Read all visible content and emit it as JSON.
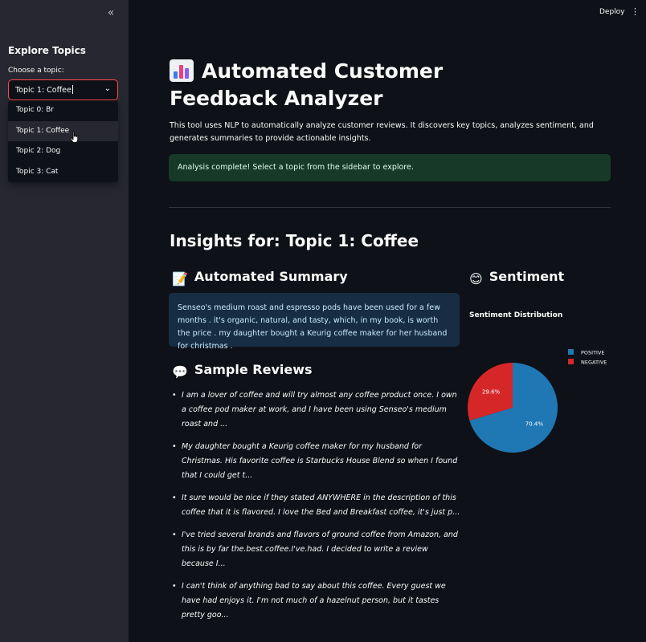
{
  "sidebar": {
    "collapse_icon": "double-chevron-left-icon",
    "title": "Explore Topics",
    "select_label": "Choose a topic:",
    "select_value": "Topic 1: Coffee",
    "options": [
      "Topic 0: Br",
      "Topic 1: Coffee",
      "Topic 2: Dog",
      "Topic 3: Cat"
    ],
    "hovered_option": "Topic 1: Coffee"
  },
  "toolbar": {
    "deploy_label": "Deploy",
    "menu_icon": "kebab-menu-icon"
  },
  "main": {
    "title": "Automated Customer Feedback Analyzer",
    "title_icon": "bar-chart-emoji",
    "description": "This tool uses NLP to automatically analyze customer reviews. It discovers key topics, analyzes sentiment, and generates summaries to provide actionable insights.",
    "success_message": "Analysis complete! Select a topic from the sidebar to explore.",
    "insights_heading": "Insights for: Topic 1: Coffee",
    "summary_heading": "Automated Summary",
    "summary_icon": "memo-emoji",
    "summary_text": "Senseo's medium roast and espresso pods have been used for a few months . it's organic, natural, and tasty, which, in my book, is worth the price . my daughter bought a Keurig coffee maker for her husband for christmas .",
    "reviews_heading": "Sample Reviews",
    "reviews_icon": "speech-bubble-emoji",
    "reviews": [
      "I am a lover of coffee and will try almost any coffee product once. I own a coffee pod maker at work, and I have been using Senseo's medium roast and ...",
      "My daughter bought a Keurig coffee maker for my husband for Christmas. His favorite coffee is Starbucks House Blend so when I found that I could get t...",
      "It sure would be nice if they stated ANYWHERE in the description of this coffee that it is flavored. I love the Bed and Breakfast coffee, it's just p...",
      "I've tried several brands and flavors of ground coffee from Amazon, and this is by far the.best.coffee.I've.had. I decided to write a review because I...",
      "I can't think of anything bad to say about this coffee. Every guest we have had enjoys it. I'm not much of a hazelnut person, but it tastes pretty goo..."
    ],
    "sentiment_heading": "Sentiment",
    "sentiment_icon": "smiling-face-emoji"
  },
  "chart_data": {
    "type": "pie",
    "title": "Sentiment Distribution",
    "categories": [
      "POSITIVE",
      "NEGATIVE"
    ],
    "values": [
      70.4,
      29.6
    ],
    "labels": [
      "70.4%",
      "29.6%"
    ],
    "colors": [
      "#1f77b4",
      "#d62728"
    ],
    "legend_position": "top-right"
  }
}
